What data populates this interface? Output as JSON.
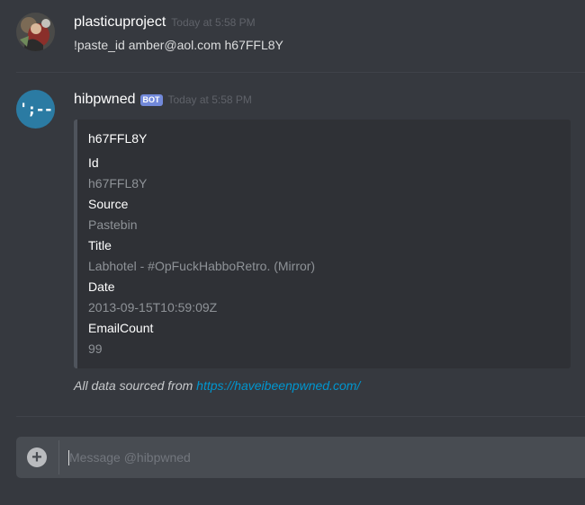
{
  "messages": [
    {
      "username": "plasticuproject",
      "timestamp": "Today at 5:58 PM",
      "content": "!paste_id amber@aol.com h67FFL8Y"
    },
    {
      "username": "hibpwned",
      "badge": "BOT",
      "timestamp": "Today at 5:58 PM",
      "avatar_text": "';--",
      "embed": {
        "title": "h67FFL8Y",
        "fields": [
          {
            "name": "Id",
            "value": "h67FFL8Y"
          },
          {
            "name": "Source",
            "value": "Pastebin"
          },
          {
            "name": "Title",
            "value": "Labhotel - #OpFuckHabboRetro. (Mirror)"
          },
          {
            "name": "Date",
            "value": "2013-09-15T10:59:09Z"
          },
          {
            "name": "EmailCount",
            "value": "99"
          }
        ]
      },
      "footer_text": "All data sourced from ",
      "footer_link": "https://haveibeenpwned.com/"
    }
  ],
  "composer": {
    "placeholder": "Message @hibpwned"
  },
  "colors": {
    "background": "#36393f",
    "embed_bg": "#2f3136",
    "embed_border": "#4f545c",
    "bot_badge": "#7289da",
    "link": "#0096cf"
  },
  "icons": {
    "avatar1": "user-avatar-photo",
    "add": "plus-circle-icon"
  }
}
